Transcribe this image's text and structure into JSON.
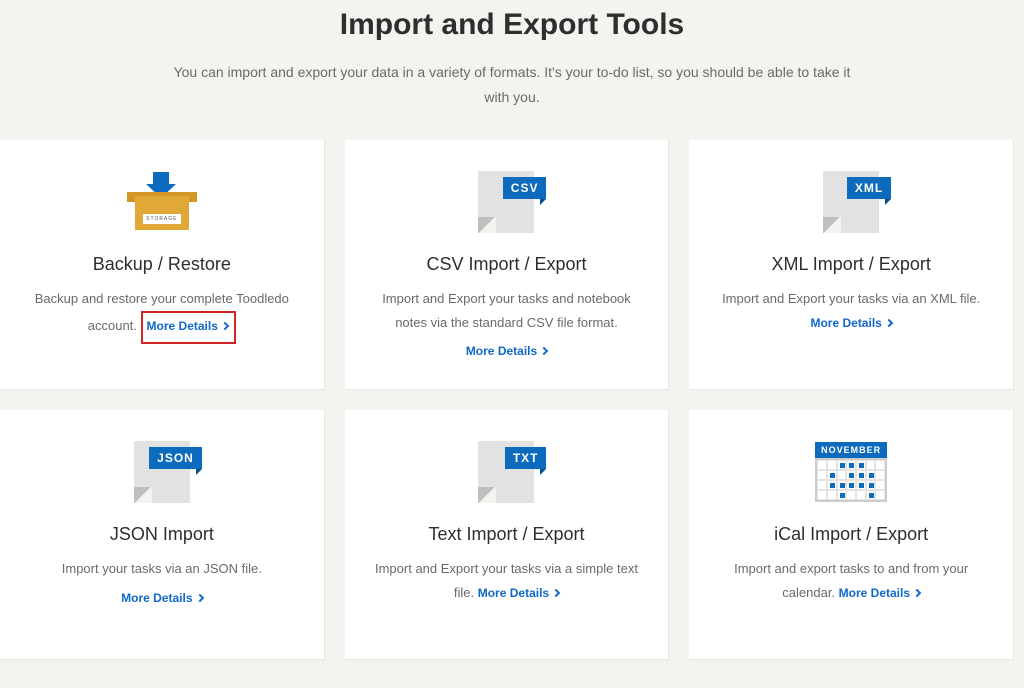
{
  "header": {
    "title": "Import and Export Tools",
    "subtitle": "You can import and export your data in a variety of formats. It's your to-do list, so you should be able to take it with you."
  },
  "more_label": "More Details",
  "cards": [
    {
      "icon": "storage-box",
      "title": "Backup / Restore",
      "desc_before": "Backup and restore your complete Toodledo account.",
      "desc_after": "",
      "more_inline": true,
      "highlight_more": true
    },
    {
      "icon": "file",
      "badge": "CSV",
      "title": "CSV Import / Export",
      "desc_before": "Import and Export your tasks and notebook notes via the standard CSV file format.",
      "desc_after": "",
      "more_inline": false
    },
    {
      "icon": "file",
      "badge": "XML",
      "title": "XML Import / Export",
      "desc_before": "Import and Export your tasks via an XML file.",
      "desc_after": "",
      "more_inline": true
    },
    {
      "icon": "file",
      "badge": "JSON",
      "title": "JSON Import",
      "desc_before": "Import your tasks via an JSON file.",
      "desc_after": "",
      "more_inline": false
    },
    {
      "icon": "file",
      "badge": "TXT",
      "title": "Text Import / Export",
      "desc_before": "Import and Export your tasks via a simple text file.",
      "desc_after": "",
      "more_inline": true
    },
    {
      "icon": "calendar",
      "cal_label": "NOVEMBER",
      "title": "iCal Import / Export",
      "desc_before": "Import and export tasks to and from your calendar.",
      "desc_after": "",
      "more_inline": true
    }
  ]
}
